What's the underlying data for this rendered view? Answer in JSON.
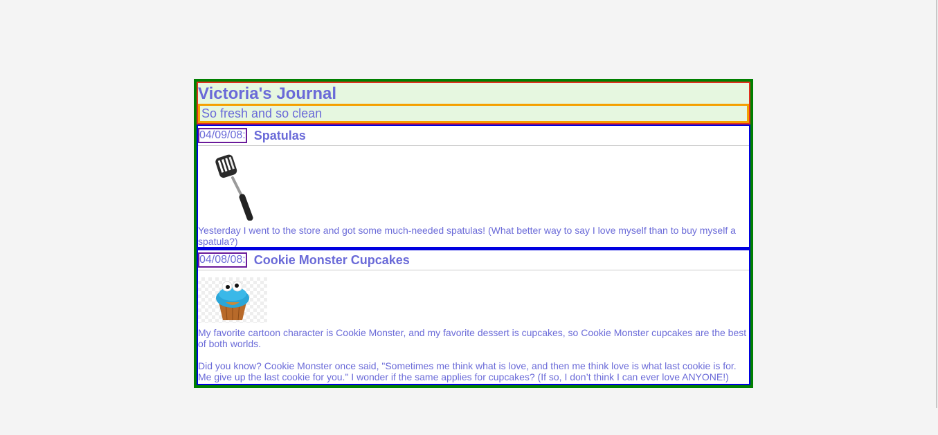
{
  "journal": {
    "title": "Victoria's Journal",
    "subtitle": "So fresh and so clean"
  },
  "entries": [
    {
      "date": "04/09/08:",
      "title": "Spatulas",
      "image": "spatula-image",
      "paragraphs": [
        "Yesterday I went to the store and got some much-needed spatulas! (What better way to say I love myself than to buy myself a spatula?)"
      ]
    },
    {
      "date": "04/08/08:",
      "title": "Cookie Monster Cupcakes",
      "image": "cupcake-image",
      "paragraphs": [
        "My favorite cartoon character is Cookie Monster, and my favorite dessert is cupcakes, so Cookie Monster cupcakes are the best of both worlds.",
        "Did you know? Cookie Monster once said, \"Sometimes me think what is love, and then me think love is what last cookie is for. Me give up the last cookie for you.\" I wonder if the same applies for cupcakes? (If so, I don’t think I can ever love ANYONE!)"
      ]
    }
  ],
  "colors": {
    "text": "#6a6ad8",
    "outer_border": "#008000",
    "header_border": "#e0301e",
    "subtitle_border": "#f5a000",
    "entry_border": "#0000e0",
    "date_border": "#6a1a9a",
    "header_bg": "#e6f7e0"
  }
}
